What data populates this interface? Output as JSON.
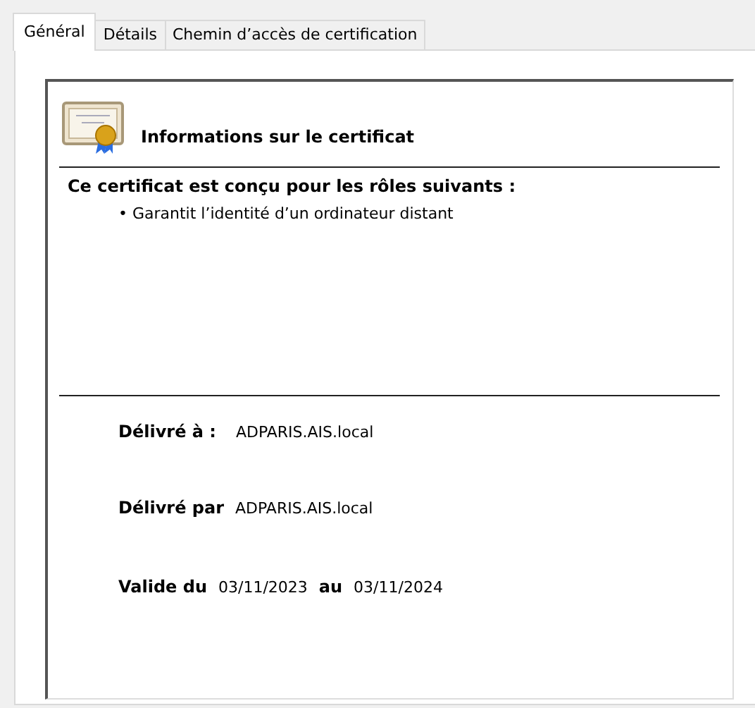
{
  "tabs": [
    {
      "label": "Général",
      "selected": true
    },
    {
      "label": "Détails",
      "selected": false
    },
    {
      "label": "Chemin d’accès de certification",
      "selected": false
    }
  ],
  "certificate": {
    "title": "Informations sur le certificat",
    "purpose_heading": "Ce certificat est conçu pour les rôles suivants :",
    "purposes": [
      "• Garantit l’identité d’un ordinateur distant"
    ],
    "issued_to": {
      "label": "Délivré à :",
      "value": "ADPARIS.AIS.local"
    },
    "issued_by": {
      "label": "Délivré par",
      "value": "ADPARIS.AIS.local"
    },
    "validity": {
      "label_from": "Valide du",
      "from": "03/11/2023",
      "label_to": "au",
      "to": "03/11/2024"
    }
  }
}
